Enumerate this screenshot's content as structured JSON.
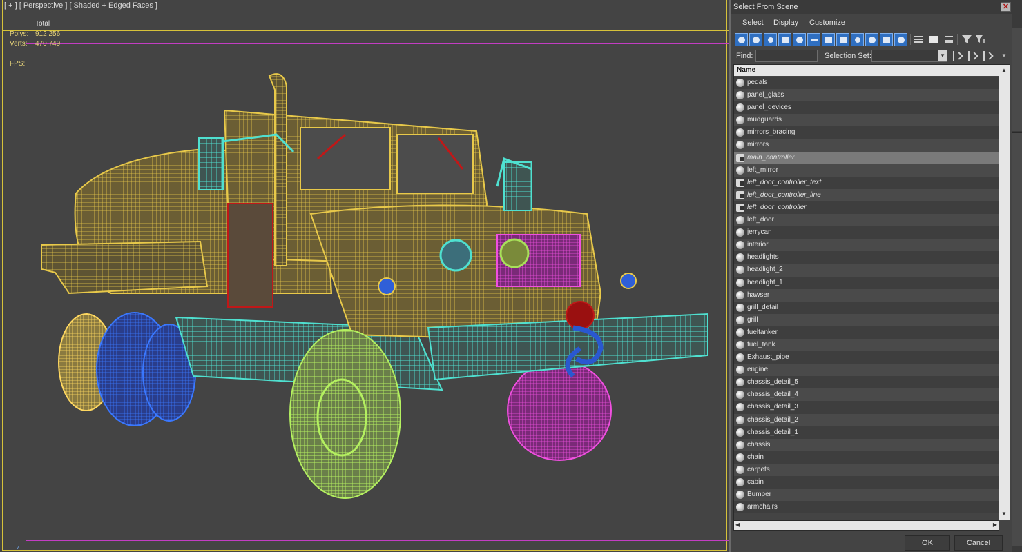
{
  "viewport": {
    "label": "[ + ] [ Perspective ] [ Shaded + Edged Faces ]",
    "stats": {
      "total_label": "Total",
      "polys_label": "Polys:",
      "polys_value": "912 256",
      "verts_label": "Verts:",
      "verts_value": "470 749",
      "fps_label": "FPS:"
    },
    "axis_label": "z"
  },
  "dialog": {
    "title": "Select From Scene",
    "close_glyph": "✕",
    "menu": [
      "Select",
      "Display",
      "Customize"
    ],
    "find_label": "Find:",
    "find_value": "",
    "selection_set_label": "Selection Set:",
    "selection_set_value": "",
    "column_header": "Name",
    "items": [
      {
        "name": "pedals",
        "type": "object"
      },
      {
        "name": "panel_glass",
        "type": "object"
      },
      {
        "name": "panel_devices",
        "type": "object"
      },
      {
        "name": "mudguards",
        "type": "object"
      },
      {
        "name": "mirrors_bracing",
        "type": "object"
      },
      {
        "name": "mirrors",
        "type": "object"
      },
      {
        "name": "main_controller",
        "type": "controller",
        "selected": true
      },
      {
        "name": "left_mirror",
        "type": "object"
      },
      {
        "name": "left_door_controller_text",
        "type": "controller"
      },
      {
        "name": "left_door_controller_line",
        "type": "controller"
      },
      {
        "name": "left_door_controller",
        "type": "controller"
      },
      {
        "name": "left_door",
        "type": "object"
      },
      {
        "name": "jerrycan",
        "type": "object"
      },
      {
        "name": "interior",
        "type": "object"
      },
      {
        "name": "headlights",
        "type": "object"
      },
      {
        "name": "headlight_2",
        "type": "object"
      },
      {
        "name": "headlight_1",
        "type": "object"
      },
      {
        "name": "hawser",
        "type": "object"
      },
      {
        "name": "grill_detail",
        "type": "object"
      },
      {
        "name": "grill",
        "type": "object"
      },
      {
        "name": "fueltanker",
        "type": "object"
      },
      {
        "name": "fuel_tank",
        "type": "object"
      },
      {
        "name": "Exhaust_pipe",
        "type": "object"
      },
      {
        "name": "engine",
        "type": "object"
      },
      {
        "name": "chassis_detail_5",
        "type": "object"
      },
      {
        "name": "chassis_detail_4",
        "type": "object"
      },
      {
        "name": "chassis_detail_3",
        "type": "object"
      },
      {
        "name": "chassis_detail_2",
        "type": "object"
      },
      {
        "name": "chassis_detail_1",
        "type": "object"
      },
      {
        "name": "chassis",
        "type": "object"
      },
      {
        "name": "chain",
        "type": "object"
      },
      {
        "name": "carpets",
        "type": "object"
      },
      {
        "name": "cabin",
        "type": "object"
      },
      {
        "name": "Bumper",
        "type": "object"
      },
      {
        "name": "armchairs",
        "type": "object"
      }
    ],
    "ok_label": "OK",
    "cancel_label": "Cancel"
  },
  "colors": {
    "viewport_bg": "#444444",
    "wire_yellow": "#e8c94a",
    "wire_cyan": "#4fe0d0",
    "wire_green": "#a8e05a",
    "wire_blue": "#2f5fd8",
    "wire_magenta": "#e040d0",
    "toolbar_blue": "#2f6fc1"
  },
  "toolbar_icons": [
    "select-all-icon",
    "select-none-icon",
    "select-invert-icon",
    "display-geometry-icon",
    "display-shapes-icon",
    "display-lights-icon",
    "display-cameras-icon",
    "display-helpers-icon",
    "display-spacewarps-icon",
    "display-groups-icon",
    "display-xrefs-icon",
    "display-bones-icon",
    "display-all-icon",
    "display-none-icon",
    "display-invert-icon",
    "filter-icon",
    "filter-options-icon"
  ]
}
